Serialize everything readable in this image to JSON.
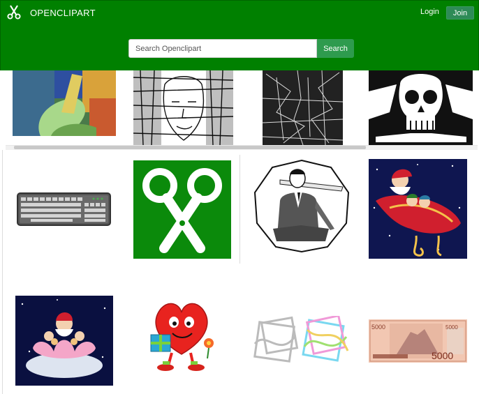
{
  "header": {
    "brand": "OPENCLIPART",
    "brand_icon": "scissors-icon",
    "login_label": "Login",
    "join_label": "Join",
    "brand_color": "#008000"
  },
  "search": {
    "placeholder": "Search Openclipart",
    "button_label": "Search"
  },
  "gallery": {
    "row1": [
      "pop-art-hand",
      "line-portrait",
      "abstract-lines",
      "skull-and-crossbones"
    ],
    "row2": [
      "keyboard",
      "scissors",
      "vintage-gentleman",
      "santa-sleigh"
    ],
    "row3": [
      "santa-lotus-cloud",
      "heart-with-gift",
      "celtic-knots",
      "banknote-5000"
    ],
    "banknote_value": "5000"
  }
}
